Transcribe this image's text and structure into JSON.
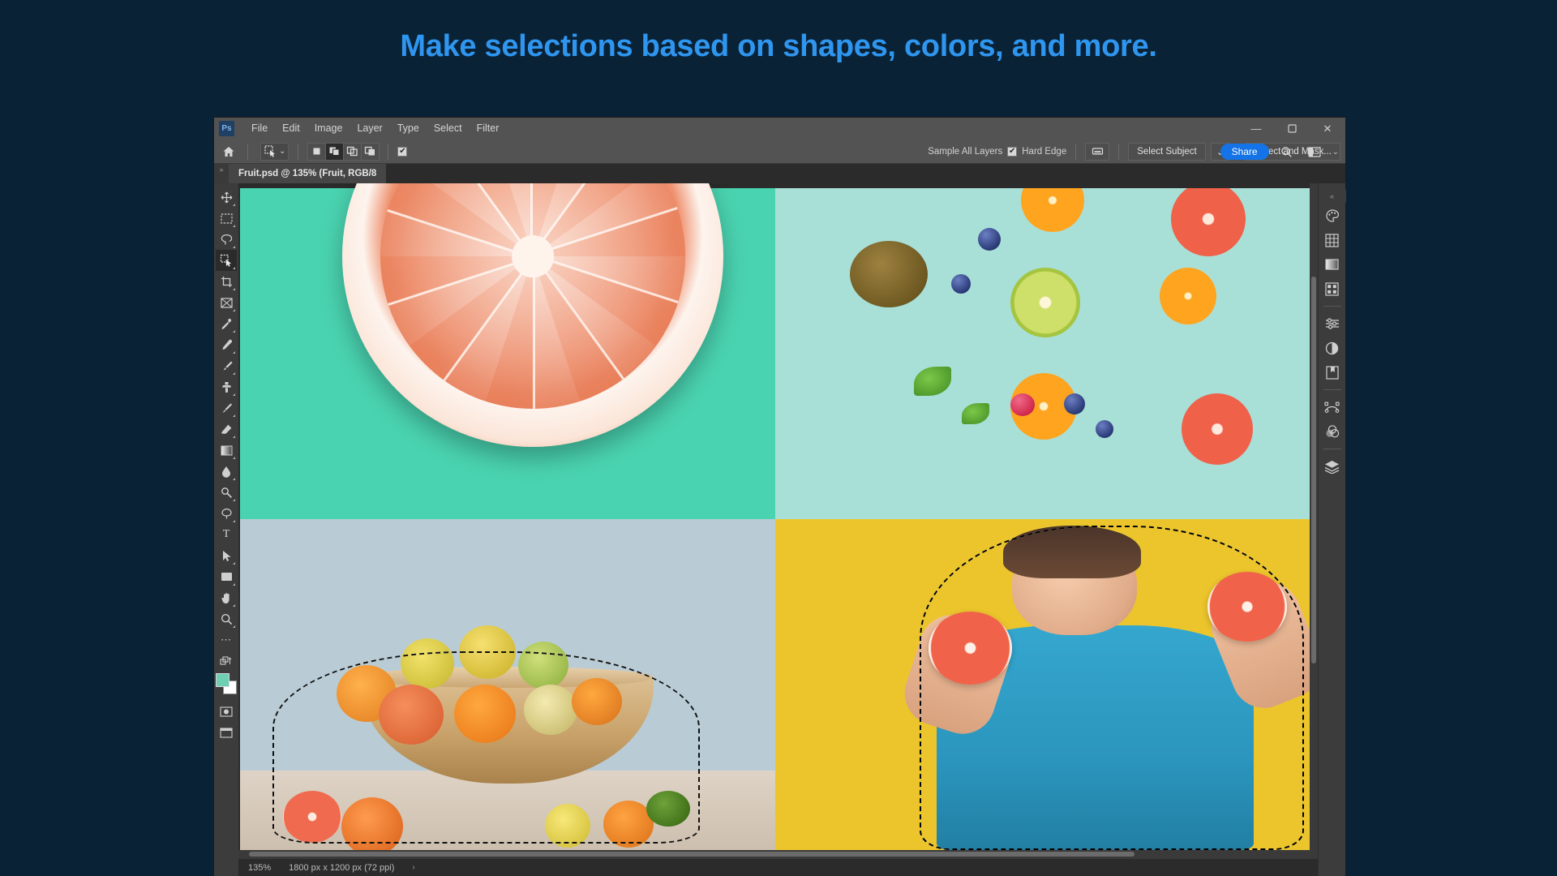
{
  "headline": "Make selections based on shapes, colors, and more.",
  "app": {
    "logo_text": "Ps",
    "menu_items": [
      "File",
      "Edit",
      "Image",
      "Layer",
      "Type",
      "Select",
      "Filter"
    ],
    "window_controls": {
      "minimize": "—",
      "maximize": "❐",
      "close": "✕"
    }
  },
  "options_bar": {
    "home_icon": "home-icon",
    "tool_preset": "quick-selection-tool-icon",
    "preset_chevron": "⌄",
    "selection_modes": [
      {
        "name": "new-selection",
        "active": false
      },
      {
        "name": "add-to-selection",
        "active": true
      },
      {
        "name": "subtract-from-selection",
        "active": false
      },
      {
        "name": "intersect-with-selection",
        "active": false
      }
    ],
    "sample_all_layers_label": "Sample All Layers",
    "hard_edge_label": "Hard Edge",
    "hard_edge_checked": true,
    "check_glyph": "✔",
    "brush_settings_icon": "brush-settings-icon",
    "select_subject_label": "Select Subject",
    "select_subject_chevron": "⌄",
    "select_and_mask_label": "Select and Mask...",
    "share_label": "Share",
    "search_icon": "search-icon",
    "workspace_icon": "workspace-icon",
    "workspace_chevron": "⌄"
  },
  "tab_bar": {
    "gutter_glyph": "»",
    "document_tab": "Fruit.psd @ 135% (Fruit, RGB/8"
  },
  "toolbar": {
    "tools": [
      {
        "name": "move-tool",
        "glyph": "✥",
        "active": false
      },
      {
        "name": "rectangular-marquee-tool",
        "glyph": "⬚",
        "active": false
      },
      {
        "name": "lasso-tool",
        "glyph": "◌",
        "active": false
      },
      {
        "name": "quick-selection-tool",
        "glyph": "⬛",
        "active": true
      },
      {
        "name": "crop-tool",
        "glyph": "⌸",
        "active": false
      },
      {
        "name": "frame-tool",
        "glyph": "⌧",
        "active": false
      },
      {
        "name": "eyedropper-tool",
        "glyph": "✒",
        "active": false
      },
      {
        "name": "spot-healing-brush-tool",
        "glyph": "❁",
        "active": false
      },
      {
        "name": "brush-tool",
        "glyph": "✐",
        "active": false
      },
      {
        "name": "clone-stamp-tool",
        "glyph": "⚓",
        "active": false
      },
      {
        "name": "history-brush-tool",
        "glyph": "✎",
        "active": false
      },
      {
        "name": "eraser-tool",
        "glyph": "◥",
        "active": false
      },
      {
        "name": "gradient-tool",
        "glyph": "■",
        "active": false
      },
      {
        "name": "blur-tool",
        "glyph": "●",
        "active": false
      },
      {
        "name": "dodge-tool",
        "glyph": "⚲",
        "active": false
      },
      {
        "name": "pen-tool",
        "glyph": "✒",
        "active": false
      },
      {
        "name": "type-tool",
        "glyph": "T",
        "active": false
      },
      {
        "name": "path-selection-tool",
        "glyph": "➤",
        "active": false
      },
      {
        "name": "rectangle-tool",
        "glyph": "▭",
        "active": false
      },
      {
        "name": "hand-tool",
        "glyph": "✋",
        "active": false
      },
      {
        "name": "zoom-tool",
        "glyph": "⌕",
        "active": false
      },
      {
        "name": "edit-toolbar-tool",
        "glyph": "⋯",
        "active": false
      }
    ],
    "foreground_color": "#6ecfb4",
    "background_color": "#ffffff",
    "quick_mask_icon": "quick-mask-icon"
  },
  "right_rail": {
    "top_glyph": "«",
    "icons": [
      {
        "name": "color-panel-icon",
        "glyph": "◔"
      },
      {
        "name": "swatches-panel-icon",
        "glyph": "⊞"
      },
      {
        "name": "gradients-panel-icon",
        "glyph": "▤"
      },
      {
        "name": "patterns-panel-icon",
        "glyph": "░"
      },
      {
        "name": "adjustments-panel-icon",
        "glyph": "≡"
      },
      {
        "name": "properties-panel-icon",
        "glyph": "◑"
      },
      {
        "name": "libraries-panel-icon",
        "glyph": "▢"
      },
      {
        "name": "paths-panel-icon",
        "glyph": "∿"
      },
      {
        "name": "channels-panel-icon",
        "glyph": "◎"
      },
      {
        "name": "layers-panel-icon",
        "glyph": "❖"
      }
    ]
  },
  "status_bar": {
    "zoom": "135%",
    "dimensions": "1800 px x 1200 px (72 ppi)",
    "arrow": "›"
  },
  "canvas": {
    "quadrants": [
      {
        "name": "grapefruit-slice-photo",
        "color": "#4ad3b0"
      },
      {
        "name": "mixed-fruit-flatlay-photo",
        "color": "#a8e0d8"
      },
      {
        "name": "fruit-bowl-photo",
        "color": "#b9ccd6"
      },
      {
        "name": "boy-with-grapefruit-photo",
        "color": "#ecc52c"
      }
    ]
  },
  "colors": {
    "page_background": "#0a2236",
    "headline": "#2f96f0",
    "accent": "#1473e6"
  }
}
